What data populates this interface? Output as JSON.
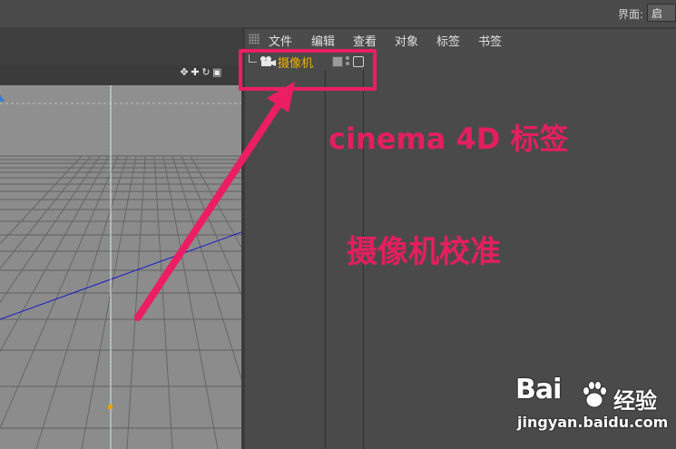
{
  "topbar": {
    "interface_label": "界面:",
    "interface_value": "启"
  },
  "object_manager": {
    "menu": [
      "文件",
      "编辑",
      "查看",
      "对象",
      "标签",
      "书签"
    ],
    "object_name": "摄像机"
  },
  "viewport_icons": [
    "move-icon",
    "zoom-icon",
    "rotate-icon",
    "maximize-icon"
  ],
  "annotations": {
    "line1": "cinema 4D 标签",
    "line2": "摄像机校准"
  },
  "watermark": {
    "logo": "Bai",
    "brand": "经验",
    "url": "jingyan.baidu.com"
  },
  "colors": {
    "accent": "#ec1e63",
    "object_name": "#f1b300"
  }
}
